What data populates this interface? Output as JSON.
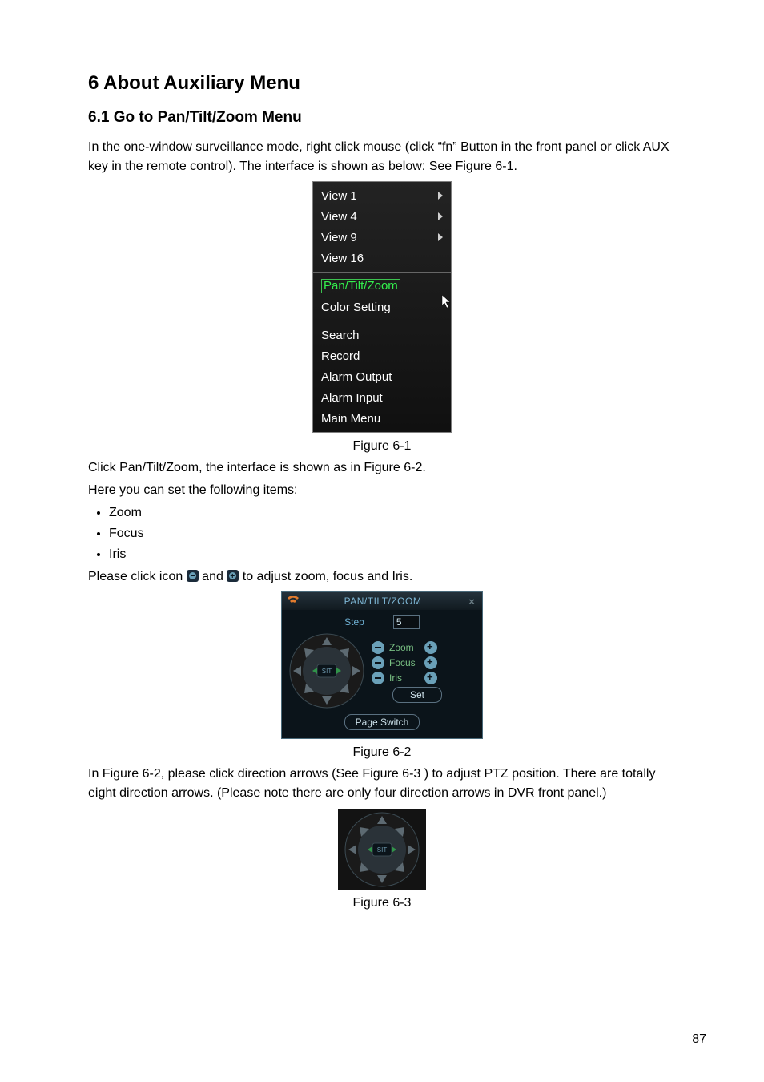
{
  "heading": "6  About Auxiliary Menu",
  "subheading": "6.1    Go to Pan/Tilt/Zoom Menu",
  "intro": "In the one-window surveillance mode, right click mouse (click “fn” Button in the front panel or click AUX key in the remote control). The interface is shown as below: See Figure 6-1.",
  "context_menu": {
    "group1": [
      {
        "label": "View 1",
        "submenu": true
      },
      {
        "label": "View 4",
        "submenu": true
      },
      {
        "label": "View 9",
        "submenu": true
      },
      {
        "label": "View 16",
        "submenu": false
      }
    ],
    "group2": [
      {
        "label": "Pan/Tilt/Zoom",
        "highlight": true
      },
      {
        "label": "Color Setting",
        "highlight": false
      }
    ],
    "group3": [
      {
        "label": "Search"
      },
      {
        "label": "Record"
      },
      {
        "label": "Alarm Output"
      },
      {
        "label": "Alarm Input"
      },
      {
        "label": "Main Menu"
      }
    ]
  },
  "fig1_caption": "Figure 6-1",
  "after_fig1_a": "Click Pan/Tilt/Zoom, the interface is shown as in Figure 6-2.",
  "after_fig1_b": "Here you can set the following items:",
  "bullets": [
    "Zoom",
    "Focus",
    "Iris"
  ],
  "click_icon_a": "Please click icon ",
  "click_icon_b": " and ",
  "click_icon_c": " to adjust zoom, focus and Iris.",
  "ptz": {
    "title": "PAN/TILT/ZOOM",
    "step_label": "Step",
    "step_value": "5",
    "rows": [
      "Zoom",
      "Focus",
      "Iris"
    ],
    "sit": "SIT",
    "set": "Set",
    "page_switch": "Page Switch"
  },
  "fig2_caption": "Figure 6-2",
  "after_fig2": "In Figure 6-2, please click direction arrows (See Figure 6-3 ) to adjust PTZ position. There are totally eight direction arrows. (Please note there are only four direction arrows in DVR front panel.)",
  "fig3_caption": "Figure 6-3",
  "page_number": "87"
}
